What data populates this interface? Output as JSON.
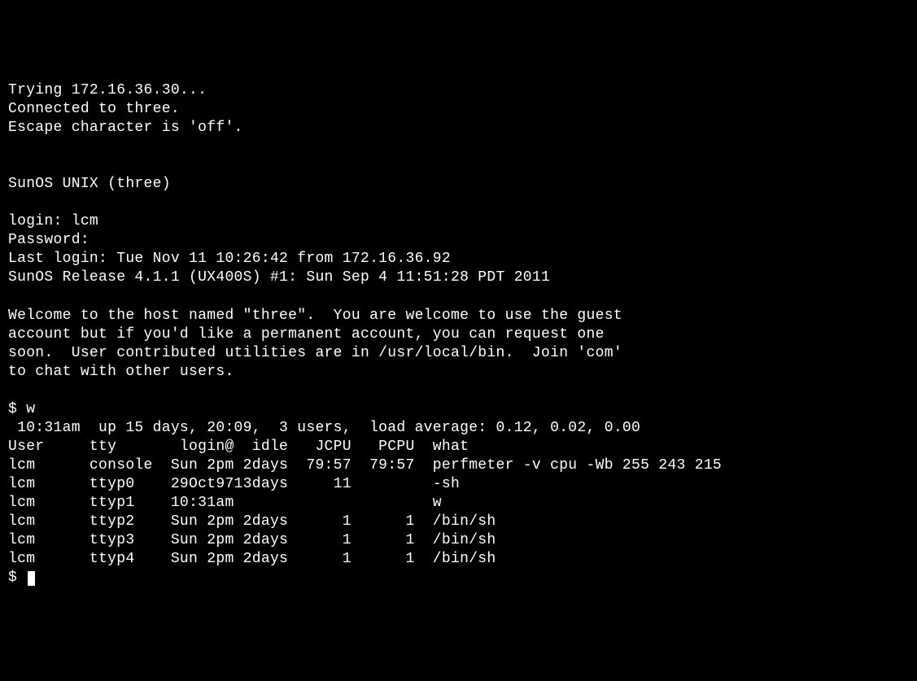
{
  "connection": {
    "trying": "Trying 172.16.36.30...",
    "connected": "Connected to three.",
    "escape": "Escape character is 'off'."
  },
  "banner": {
    "system": "SunOS UNIX (three)"
  },
  "login": {
    "login_prompt": "login: lcm",
    "password_prompt": "Password:",
    "last_login": "Last login: Tue Nov 11 10:26:42 from 172.16.36.92",
    "release": "SunOS Release 4.1.1 (UX400S) #1: Sun Sep 4 11:51:28 PDT 2011"
  },
  "motd": {
    "line1": "Welcome to the host named \"three\".  You are welcome to use the guest",
    "line2": "account but if you'd like a permanent account, you can request one",
    "line3": "soon.  User contributed utilities are in /usr/local/bin.  Join 'com'",
    "line4": "to chat with other users."
  },
  "command": {
    "prompt1": "$ w",
    "summary": " 10:31am  up 15 days, 20:09,  3 users,  load average: 0.12, 0.02, 0.00",
    "header": "User     tty       login@  idle   JCPU   PCPU  what",
    "rows": [
      "lcm      console  Sun 2pm 2days  79:57  79:57  perfmeter -v cpu -Wb 255 243 215",
      "lcm      ttyp0    29Oct9713days     11         -sh",
      "lcm      ttyp1    10:31am                      w",
      "lcm      ttyp2    Sun 2pm 2days      1      1  /bin/sh",
      "lcm      ttyp3    Sun 2pm 2days      1      1  /bin/sh",
      "lcm      ttyp4    Sun 2pm 2days      1      1  /bin/sh"
    ],
    "prompt2": "$ "
  }
}
